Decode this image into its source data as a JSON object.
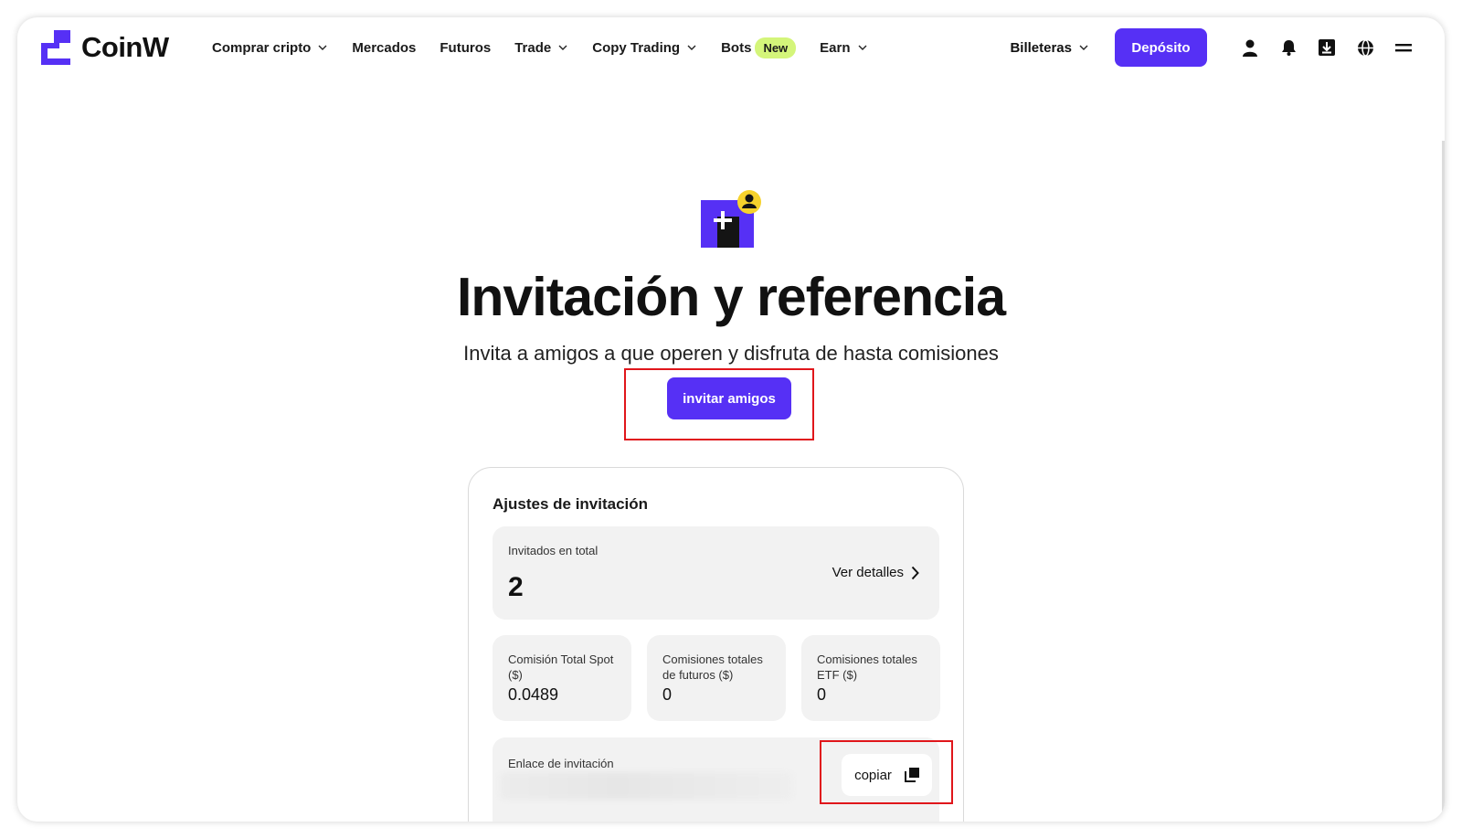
{
  "header": {
    "brand": "CoinW",
    "nav": [
      {
        "label": "Comprar cripto",
        "dropdown": true
      },
      {
        "label": "Mercados",
        "dropdown": false
      },
      {
        "label": "Futuros",
        "dropdown": false
      },
      {
        "label": "Trade",
        "dropdown": true
      },
      {
        "label": "Copy Trading",
        "dropdown": true
      },
      {
        "label": "Bots",
        "badge": "New"
      },
      {
        "label": "Earn",
        "dropdown": true
      }
    ],
    "wallets_label": "Billeteras",
    "deposit_label": "Depósito",
    "icons": [
      "user-icon",
      "bell-icon",
      "download-icon",
      "globe-icon",
      "menu-icon"
    ]
  },
  "hero": {
    "title": "Invitación y referencia",
    "subtitle": "Invita a amigos a que operen y disfruta de hasta comisiones",
    "invite_button": "invitar amigos"
  },
  "card": {
    "title": "Ajustes de invitación",
    "total_invited_label": "Invitados en total",
    "total_invited_value": "2",
    "details_label": "Ver detalles",
    "stats": [
      {
        "label": "Comisión Total Spot ($)",
        "value": "0.0489"
      },
      {
        "label": "Comisiones totales de futuros ($)",
        "value": "0"
      },
      {
        "label": "Comisiones totales ETF ($)",
        "value": "0"
      }
    ],
    "link_label": "Enlace de invitación",
    "copy_label": "copiar"
  },
  "colors": {
    "accent": "#5630f5",
    "badge": "#d4f57a",
    "highlight": "#e0161b",
    "panel": "#f2f2f2"
  }
}
